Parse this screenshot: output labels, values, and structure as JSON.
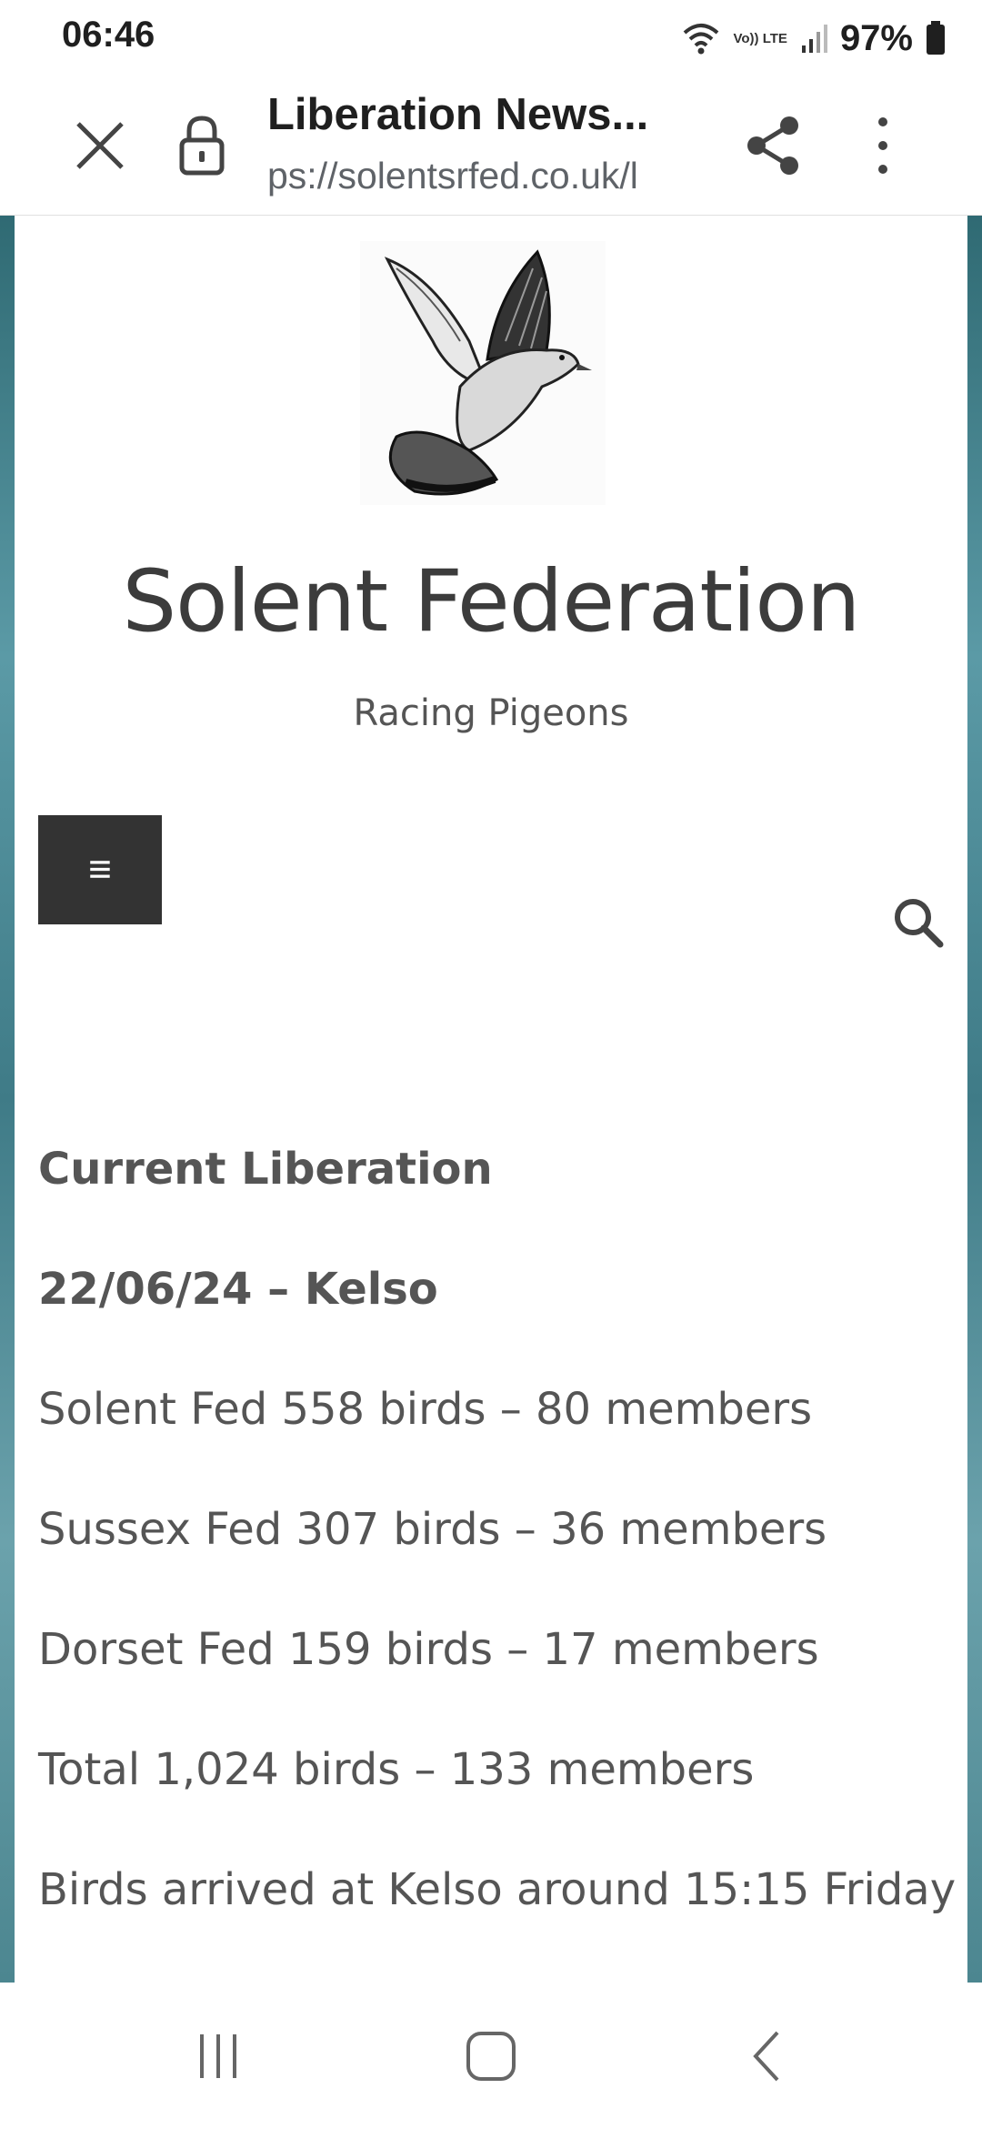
{
  "status_bar": {
    "time": "06:46",
    "battery": "97%",
    "network_label": "Vo)) LTE"
  },
  "toolbar": {
    "title": "Liberation News...",
    "url": "ps://solentsrfed.co.uk/l"
  },
  "site": {
    "title": "Solent Federation",
    "tagline": "Racing Pigeons",
    "menu_icon": "≡"
  },
  "article": {
    "heading": "Current Liberation",
    "subheading": "22/06/24 – Kelso",
    "lines": [
      "Solent Fed 558 birds – 80 members",
      "Sussex Fed 307 birds – 36 members",
      "Dorset Fed 159 birds – 17 members",
      "Total 1,024 birds – 133 members",
      "Birds arrived at Kelso around 15:15 Friday"
    ]
  },
  "icons": {
    "close": "close-icon",
    "lock": "lock-icon",
    "share": "share-icon",
    "menu": "more-vert-icon",
    "search": "search-icon",
    "recents": "recents-icon",
    "home": "home-icon",
    "back": "back-icon",
    "wifi": "wifi-icon",
    "signal": "signal-icon",
    "battery": "battery-icon",
    "logo": "pigeon-logo"
  }
}
